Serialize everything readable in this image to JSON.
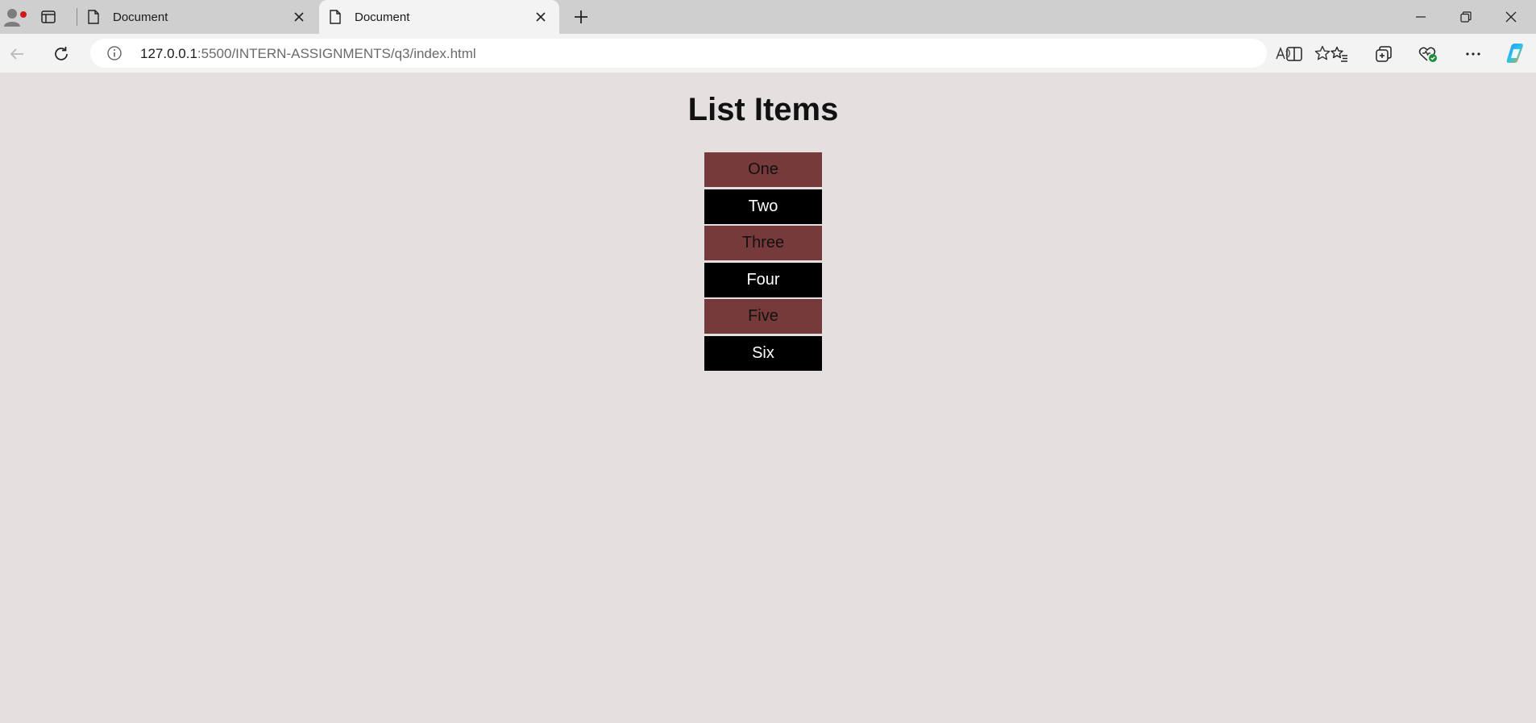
{
  "browser": {
    "tabs": [
      {
        "title": "Document",
        "active": false
      },
      {
        "title": "Document",
        "active": true
      }
    ],
    "address": {
      "host": "127.0.0.1",
      "rest": ":5500/INTERN-ASSIGNMENTS/q3/index.html"
    }
  },
  "page": {
    "title": "List Items",
    "items": [
      "One",
      "Two",
      "Three",
      "Four",
      "Five",
      "Six"
    ]
  },
  "colors": {
    "odd_item_bg": "#773a3a",
    "even_item_bg": "#000000",
    "page_bg": "#e3e0df"
  }
}
